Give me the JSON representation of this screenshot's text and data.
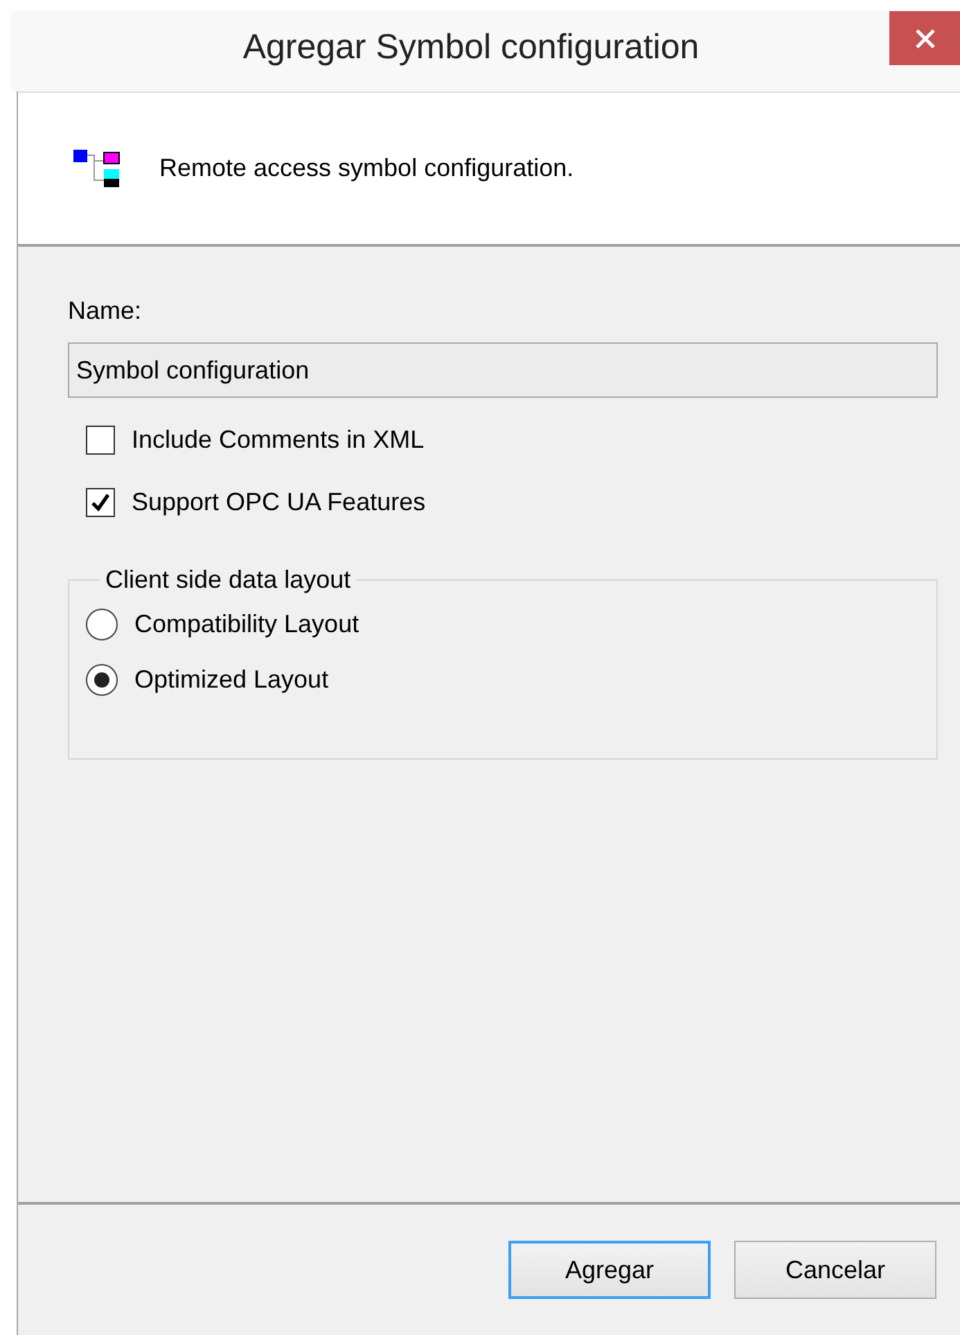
{
  "window": {
    "title": "Agregar Symbol configuration"
  },
  "header": {
    "description": "Remote access symbol configuration."
  },
  "name_field": {
    "label": "Name:",
    "value": "Symbol configuration"
  },
  "options": [
    {
      "label": "Include Comments in XML",
      "checked": false
    },
    {
      "label": "Support OPC UA Features",
      "checked": true
    }
  ],
  "layout_group": {
    "title": "Client side data layout",
    "choices": [
      {
        "label": "Compatibility Layout",
        "selected": false
      },
      {
        "label": "Optimized Layout",
        "selected": true
      }
    ]
  },
  "buttons": [
    {
      "label": "Agregar",
      "kind": "default"
    },
    {
      "label": "Cancelar",
      "kind": "normal"
    }
  ]
}
